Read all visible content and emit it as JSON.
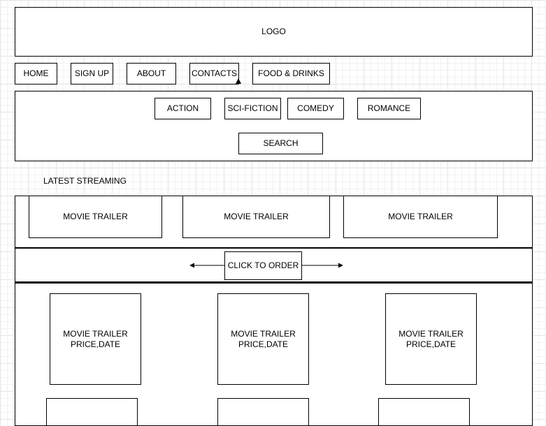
{
  "header": {
    "logo": "LOGO"
  },
  "nav": {
    "items": [
      {
        "label": "HOME"
      },
      {
        "label": "SIGN UP"
      },
      {
        "label": "ABOUT"
      },
      {
        "label": "CONTACTS"
      },
      {
        "label": "FOOD & DRINKS"
      }
    ]
  },
  "genres": {
    "items": [
      {
        "label": "ACTION"
      },
      {
        "label": "SCI-FICTION"
      },
      {
        "label": "COMEDY"
      },
      {
        "label": "ROMANCE"
      }
    ],
    "search_label": "SEARCH"
  },
  "latest": {
    "title": "LATEST STREAMING",
    "trailers": [
      {
        "label": "MOVIE TRAILER"
      },
      {
        "label": "MOVIE TRAILER"
      },
      {
        "label": "MOVIE TRAILER"
      }
    ],
    "order_label": "CLICK TO ORDER"
  },
  "products": {
    "cards": [
      {
        "title": "MOVIE TRAILER",
        "meta": "PRICE,DATE"
      },
      {
        "title": "MOVIE TRAILER",
        "meta": "PRICE,DATE"
      },
      {
        "title": "MOVIE TRAILER",
        "meta": "PRICE,DATE"
      }
    ]
  }
}
